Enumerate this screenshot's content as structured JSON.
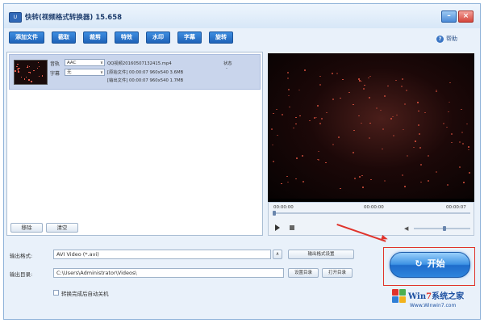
{
  "window": {
    "title": "快转(视频格式转换器) 15.658",
    "app_icon_text": "U"
  },
  "toolbar": {
    "items": [
      "添加文件",
      "截取",
      "裁剪",
      "特效",
      "水印",
      "字幕",
      "旋转"
    ]
  },
  "help": {
    "label": "帮助"
  },
  "file_list": {
    "row": {
      "audio_label": "音轨",
      "audio_value": "AAC",
      "subtitle_label": "字幕",
      "subtitle_value": "无",
      "filename": "QQ视频20160507132415.mp4",
      "status_header": "状态",
      "status_value": "-",
      "source_line": "[原始文件] 00:00:07 960x540 3.6MB",
      "output_line": "[输出文件] 00:00:07 960x540 1.7MB"
    },
    "remove_button": "移除",
    "clear_button": "清空"
  },
  "player": {
    "time_start": "00:00:00",
    "time_mid": "00:00:00",
    "time_end": "00:00:07"
  },
  "output": {
    "format_label": "输出格式:",
    "format_value": "AVI Video (*.avi)",
    "format_settings_button": "输出格式设置",
    "dir_label": "输出目录:",
    "dir_value": "C:\\Users\\Administrator\\Videos\\",
    "set_dir_button": "设置目录",
    "open_dir_button": "打开目录",
    "shutdown_label": "转换完成后自动关机",
    "shutdown_checked": false
  },
  "start_button": {
    "label": "开始",
    "icon": "refresh-icon"
  },
  "watermark": {
    "brand_prefix": "Win",
    "brand_seven": "7",
    "brand_suffix": "系统之家",
    "url": "Www.Winwin7.com"
  },
  "colors": {
    "accent_blue": "#1f63b8",
    "highlight_red": "#e0332b"
  }
}
